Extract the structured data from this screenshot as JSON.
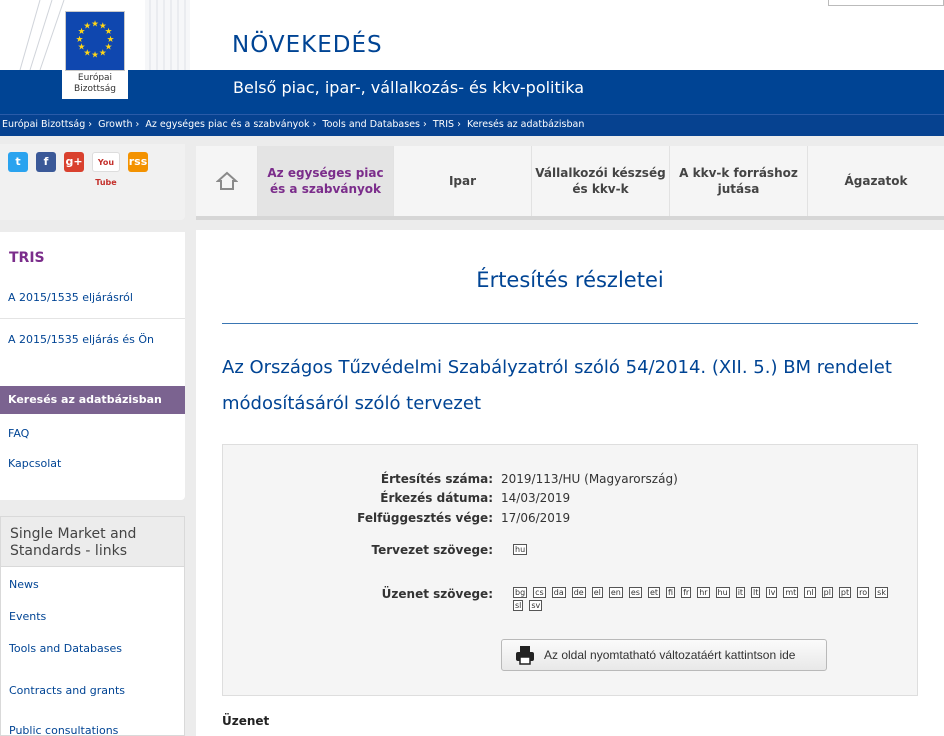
{
  "header": {
    "logo_line1": "Európai",
    "logo_line2": "Bizottság",
    "title": "NÖVEKEDÉS",
    "subtitle": "Belső piac, ipar-, vállalkozás- és kkv-politika"
  },
  "breadcrumb": [
    "Európai Bizottság",
    "Growth",
    "Az egységes piac és a szabványok",
    "Tools and Databases",
    "TRIS",
    "Keresés az adatbázisban"
  ],
  "breadcrumb_sep": "›",
  "social": {
    "twitter": "t",
    "facebook": "f",
    "gplus": "g+",
    "youtube": "You Tube",
    "rss": "rss"
  },
  "nav": {
    "items": [
      {
        "label": "Az egységes piac és a szabványok",
        "active": true
      },
      {
        "label": "Ipar"
      },
      {
        "label": "Vállalkozói készség és kkv-k"
      },
      {
        "label": "A kkv-k forráshoz jutása"
      },
      {
        "label": "Ágazatok"
      }
    ]
  },
  "sidebar_tris": {
    "title": "TRIS",
    "links": [
      "A 2015/1535 eljárásról",
      "A 2015/1535 eljárás és Ön",
      "Keresés az adatbázisban",
      "FAQ",
      "Kapcsolat"
    ]
  },
  "sidebar_links": {
    "title": "Single Market and Standards - links",
    "links": [
      "News",
      "Events",
      "Tools and Databases",
      "Contracts and grants",
      "Public consultations"
    ]
  },
  "main": {
    "page_title": "Értesítés részletei",
    "notification_title": "Az Országos Tűzvédelmi Szabályzatról szóló 54/2014. (XII. 5.) BM rendelet módosításáról szóló tervezet",
    "details": {
      "number_label": "Értesítés száma:",
      "number_value": "2019/113/HU (Magyarország)",
      "arrival_label": "Érkezés dátuma:",
      "arrival_value": "14/03/2019",
      "suspension_label": "Felfüggesztés vége:",
      "suspension_value": "17/06/2019",
      "draft_label": "Tervezet szövege:",
      "draft_langs": [
        "hu"
      ],
      "message_label": "Üzenet szövege:",
      "message_langs": [
        "bg",
        "cs",
        "da",
        "de",
        "el",
        "en",
        "es",
        "et",
        "fi",
        "fr",
        "hr",
        "hu",
        "it",
        "lt",
        "lv",
        "mt",
        "nl",
        "pl",
        "pt",
        "ro",
        "sk",
        "sl",
        "sv"
      ]
    },
    "print_button": "Az oldal nyomtatható változatáért kattintson ide",
    "message_heading": "Üzenet"
  }
}
